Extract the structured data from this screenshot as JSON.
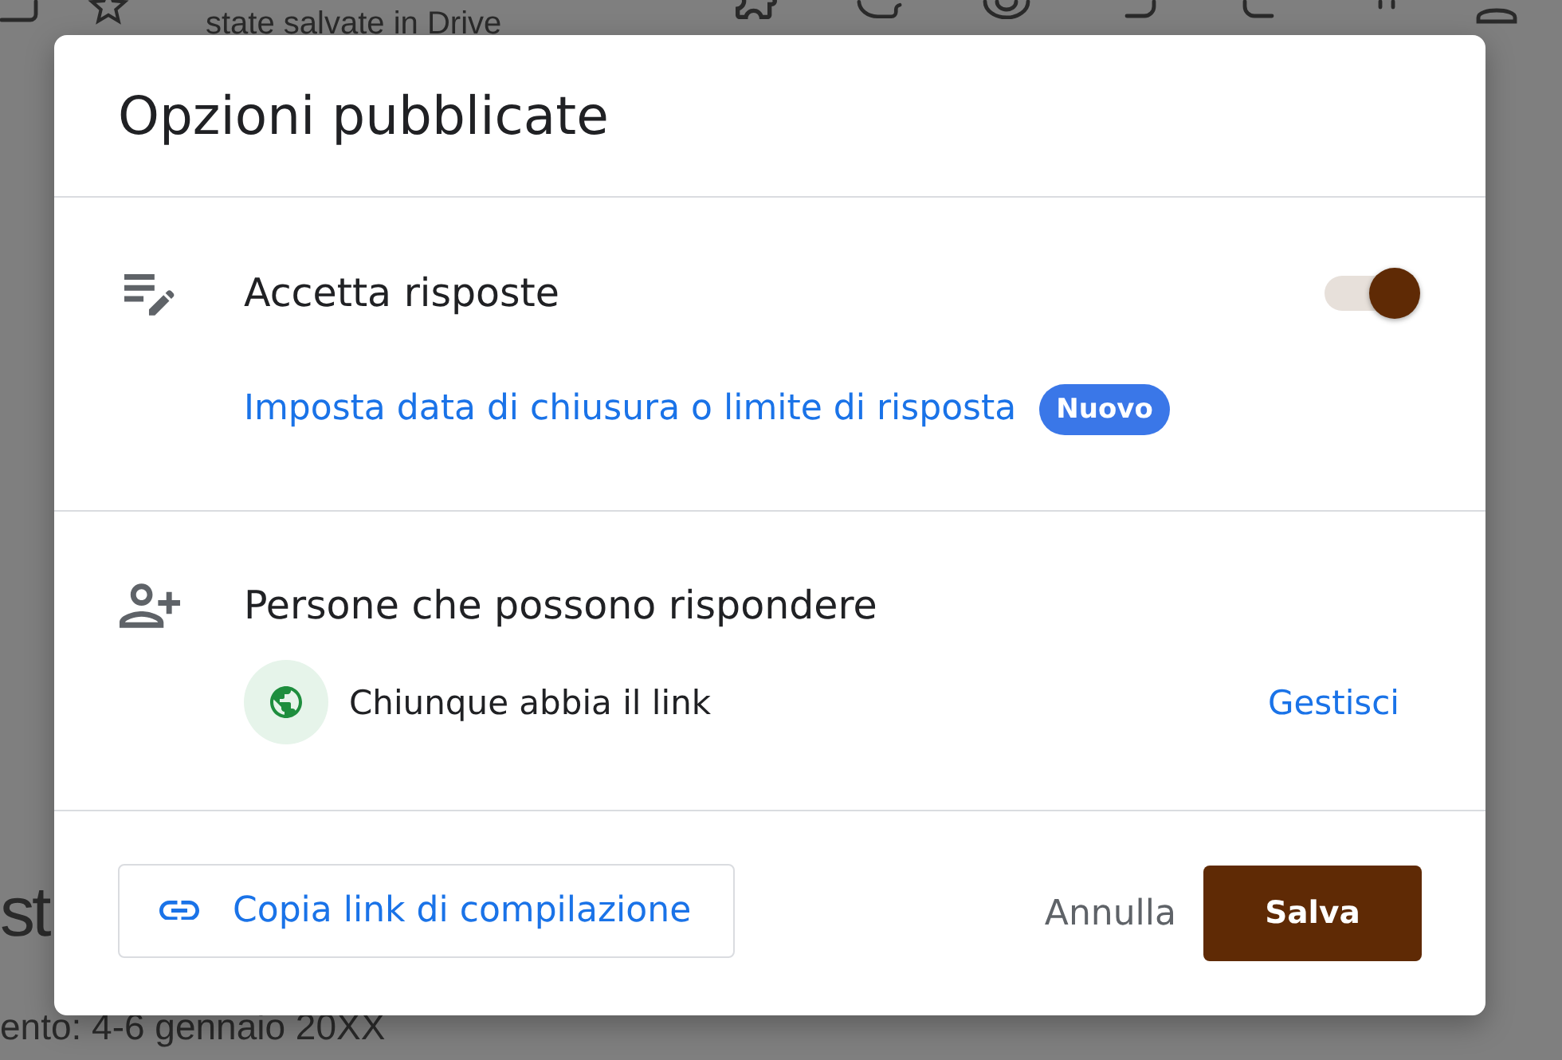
{
  "background": {
    "toolbar_subtitle": "state salvate in Drive",
    "heading": "st",
    "event_dates": "ento: 4-6 gennaio 20XX"
  },
  "dialog": {
    "title": "Opzioni pubblicate",
    "sections": [
      {
        "kind": "toggle",
        "title": "Accetta risposte",
        "on": true,
        "link": "Imposta data di chiusura o limite di risposta",
        "badge": "Nuovo"
      },
      {
        "kind": "audience",
        "title": "Persone che possono rispondere",
        "audience": "Chiunque abbia il link",
        "action": "Gestisci"
      }
    ],
    "copy_link_button": "Copia link di compilazione",
    "buttons": [
      {
        "kind": "text",
        "label": "Annulla"
      },
      {
        "kind": "primary",
        "label": "Salva"
      }
    ]
  }
}
